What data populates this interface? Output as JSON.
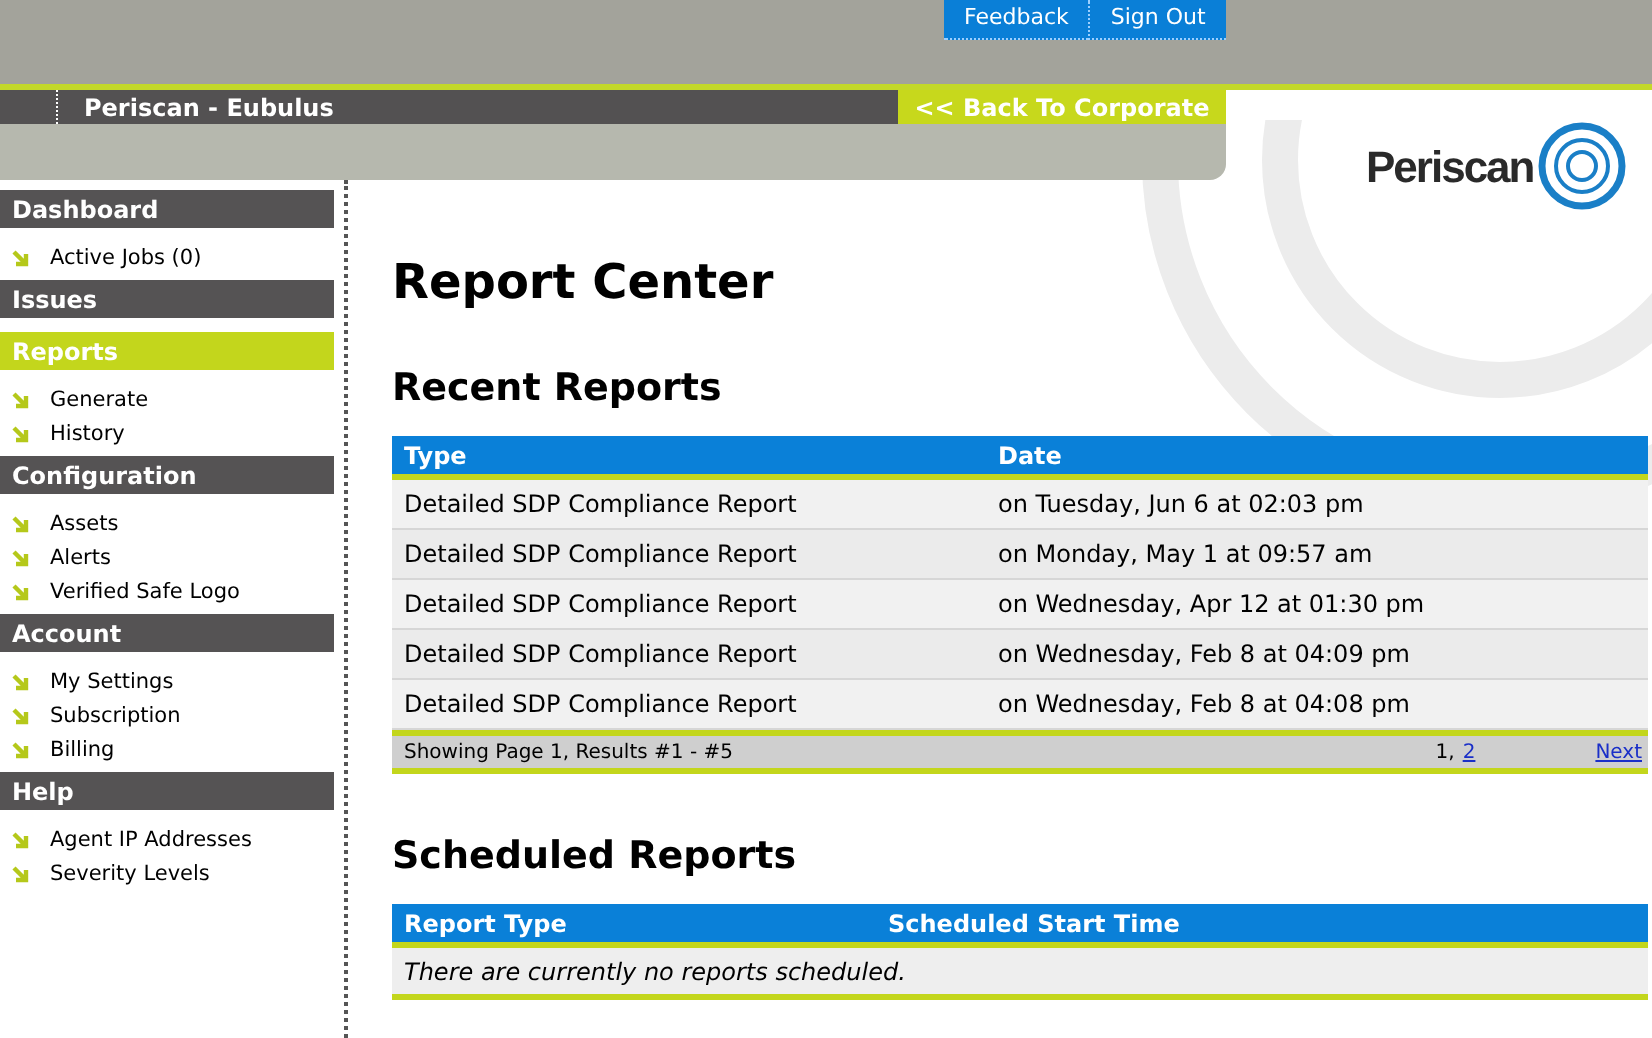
{
  "top_links": [
    {
      "label": "Feedback"
    },
    {
      "label": "Sign Out"
    }
  ],
  "site_title": "Periscan - Eubulus",
  "back_link": "<< Back To Corporate",
  "logo": {
    "text": "Periscan"
  },
  "sidebar": [
    {
      "label": "Dashboard",
      "selected": false,
      "items": [
        "Active Jobs (0)"
      ]
    },
    {
      "label": "Issues",
      "selected": false
    },
    {
      "label": "Reports",
      "selected": true,
      "items": [
        "Generate",
        "History"
      ]
    },
    {
      "label": "Configuration",
      "selected": false,
      "items": [
        "Assets",
        "Alerts",
        "Verified Safe Logo"
      ]
    },
    {
      "label": "Account",
      "selected": false,
      "items": [
        "My Settings",
        "Subscription",
        "Billing"
      ]
    },
    {
      "label": "Help",
      "selected": false,
      "items": [
        "Agent IP Addresses",
        "Severity Levels"
      ]
    }
  ],
  "page_title": "Report Center",
  "recent": {
    "title": "Recent Reports",
    "columns": [
      "Type",
      "Date"
    ],
    "rows": [
      [
        "Detailed SDP Compliance Report",
        "on Tuesday, Jun 6 at 02:03 pm"
      ],
      [
        "Detailed SDP Compliance Report",
        "on Monday, May 1 at 09:57 am"
      ],
      [
        "Detailed SDP Compliance Report",
        "on Wednesday, Apr 12 at 01:30 pm"
      ],
      [
        "Detailed SDP Compliance Report",
        "on Wednesday, Feb 8 at 04:09 pm"
      ],
      [
        "Detailed SDP Compliance Report",
        "on Wednesday, Feb 8 at 04:08 pm"
      ]
    ],
    "footer": {
      "summary": "Showing Page 1, Results #1 - #5",
      "pages": [
        {
          "label": "1",
          "selected": true
        },
        {
          "label": "2",
          "selected": false
        }
      ],
      "separator": ",",
      "next": "Next"
    }
  },
  "scheduled": {
    "title": "Scheduled Reports",
    "columns": [
      "Report Type",
      "Scheduled Start Time"
    ],
    "empty_message": "There are currently no reports scheduled."
  }
}
